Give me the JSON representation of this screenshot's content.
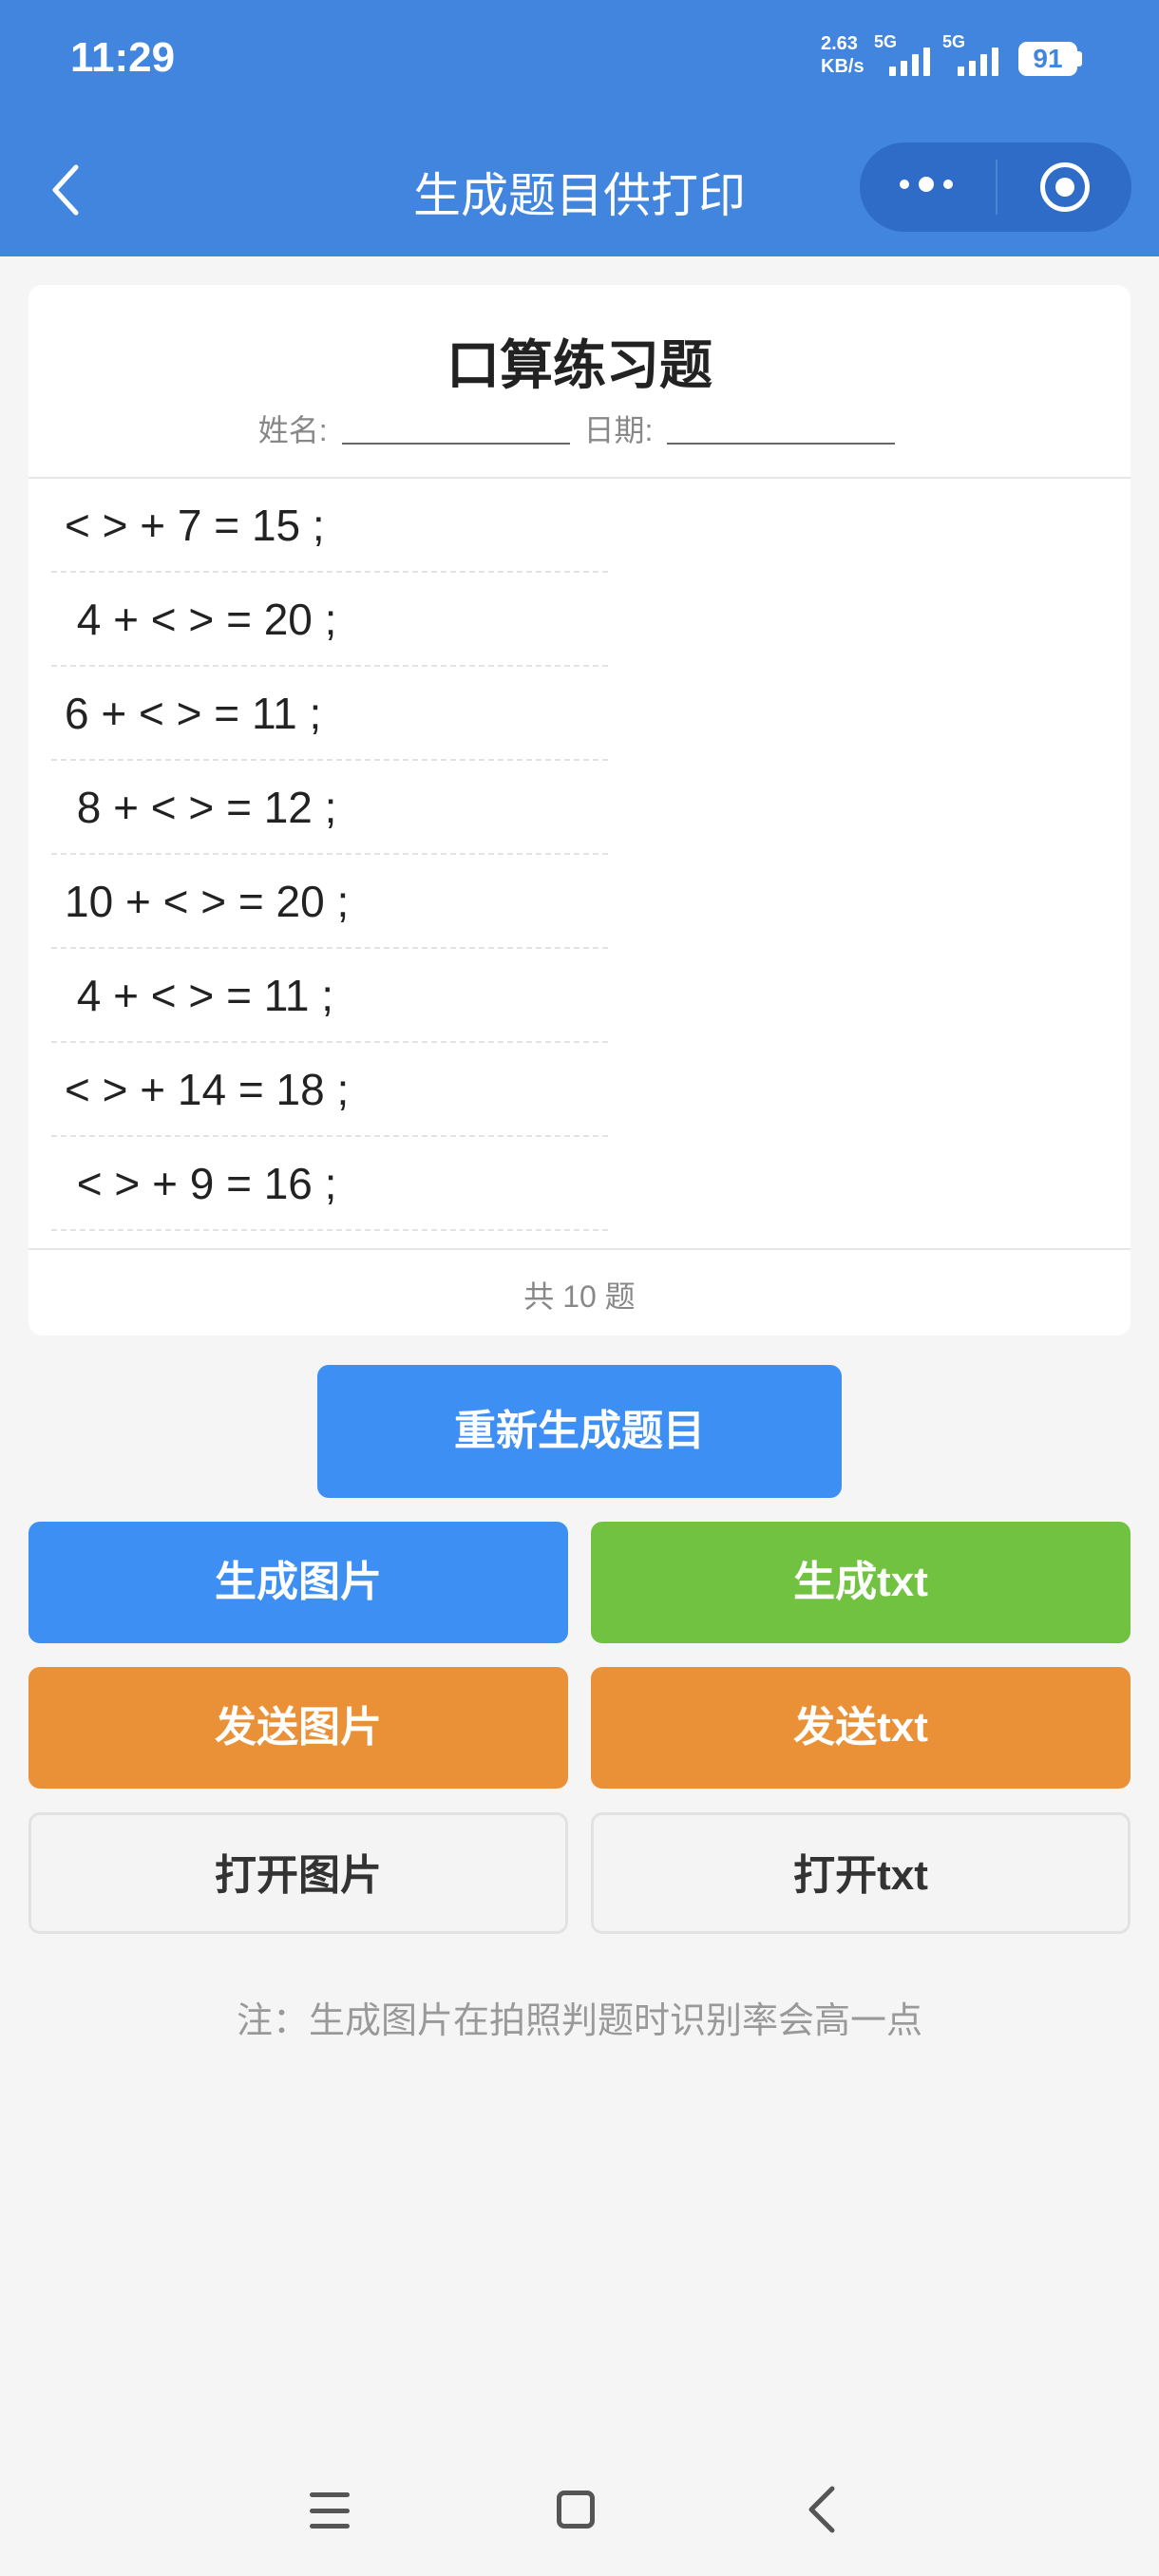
{
  "status_bar": {
    "time": "11:29",
    "net_speed_value": "2.63",
    "net_speed_unit": "KB/s",
    "sim1": "5G",
    "sim2": "5G",
    "battery": "91"
  },
  "nav": {
    "title": "生成题目供打印",
    "icons": [
      "back-icon",
      "more-icon",
      "target-icon"
    ]
  },
  "sheet": {
    "title": "口算练习题",
    "name_label": "姓名:",
    "date_label": "日期:",
    "questions": [
      "< > + 7 = 15 ;",
      " 4 + < > = 20 ;",
      "6 + < > = 11 ;",
      " 8 + < > = 12 ;",
      "10 + < > = 20 ;",
      " 4 + < > = 11 ;",
      "< > + 14 = 18 ;",
      " < > + 9 = 16 ;"
    ],
    "total": "共 10 题"
  },
  "actions": {
    "regenerate": "重新生成题目",
    "gen_image": "生成图片",
    "gen_txt": "生成txt",
    "send_image": "发送图片",
    "send_txt": "发送txt",
    "open_image": "打开图片",
    "open_txt": "打开txt"
  },
  "note": "注：生成图片在拍照判题时识别率会高一点",
  "colors": {
    "header": "#4285de",
    "blue_button": "#3e8ff3",
    "green_button": "#72c242",
    "orange_button": "#ea9138"
  }
}
